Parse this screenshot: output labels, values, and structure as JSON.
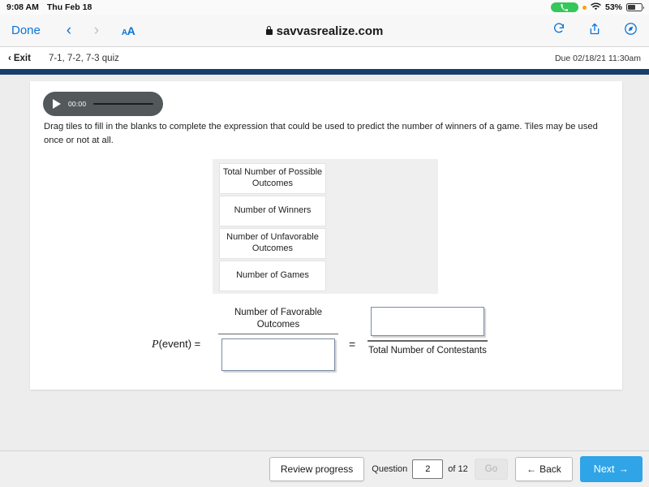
{
  "status_bar": {
    "time": "9:08 AM",
    "date": "Thu Feb 18",
    "phone_icon": "phone-icon",
    "recording_dot": "orange-status-dot",
    "wifi_icon": "wifi-icon",
    "battery_percent": "53%",
    "battery_icon": "battery-icon"
  },
  "browser": {
    "done_label": "Done",
    "back_icon": "chevron-left-icon",
    "forward_icon": "chevron-right-icon",
    "text_size_label": "AA",
    "lock_icon": "lock-icon",
    "url": "savvasrealize.com",
    "reload_icon": "reload-icon",
    "share_icon": "share-icon",
    "tabs_icon": "compass-icon"
  },
  "app_bar": {
    "exit_icon": "chevron-left-icon",
    "exit_label": "Exit",
    "assignment_title": "7-1, 7-2, 7-3 quiz",
    "due_text": "Due 02/18/21 11:30am"
  },
  "audio": {
    "play_icon": "play-icon",
    "time": "00:00"
  },
  "question": {
    "prompt": "Drag tiles to fill in the blanks to complete the expression that could be used to predict the number of winners of a game. Tiles may be used once or not at all.",
    "tiles": [
      "Total Number of Possible Outcomes",
      "Number of Winners",
      "Number of Unfavorable Outcomes",
      "Number of Games"
    ],
    "equation": {
      "label": "P(event) =",
      "label_italic": "P",
      "label_rest": "(event) =",
      "left_numerator": "Number of Favorable Outcomes",
      "left_denominator_value": "",
      "equals": "=",
      "right_numerator_value": "",
      "right_denominator": "Total Number of Contestants"
    }
  },
  "toolbar": {
    "review_label": "Review progress",
    "question_label": "Question",
    "question_number": "2",
    "of_label": "of 12",
    "go_label": "Go",
    "back_icon": "arrow-left-icon",
    "back_label": "Back",
    "next_label": "Next",
    "next_icon": "arrow-right-icon"
  },
  "colors": {
    "accent_blue": "#0a74d8",
    "next_button": "#2fa4e7",
    "navy_bar": "#17406b",
    "dropbox_border": "#7a8ba5",
    "audio_bg": "#53585a"
  }
}
